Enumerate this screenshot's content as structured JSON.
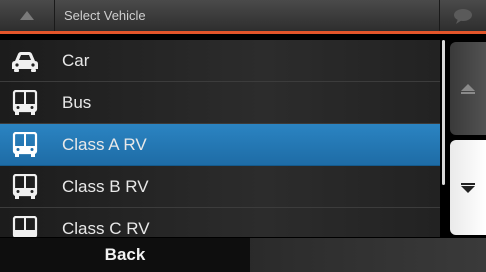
{
  "header": {
    "title": "Select Vehicle",
    "up_icon": "triangle-up-icon",
    "message_icon": "speech-bubble-icon",
    "accent": "#e3552a"
  },
  "vehicles": [
    {
      "label": "Car",
      "icon": "car-icon",
      "selected": false
    },
    {
      "label": "Bus",
      "icon": "bus-icon",
      "selected": false
    },
    {
      "label": "Class A RV",
      "icon": "rv-icon",
      "selected": true
    },
    {
      "label": "Class B RV",
      "icon": "rv-icon",
      "selected": false
    },
    {
      "label": "Class C RV",
      "icon": "rv-icon",
      "selected": false
    }
  ],
  "scrollbar": {
    "up_icon": "triangle-up-icon",
    "down_icon": "triangle-down-icon"
  },
  "footer": {
    "back_label": "Back"
  },
  "colors": {
    "selected_row": "#2b84c2"
  }
}
